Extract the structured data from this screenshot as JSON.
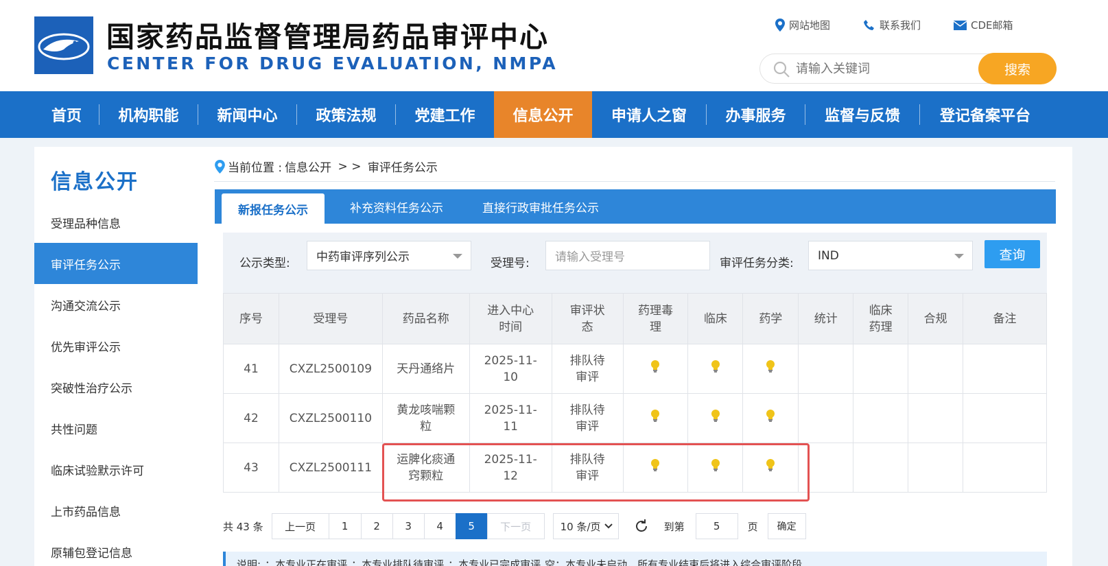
{
  "header": {
    "title": "国家药品监督管理局药品审评中心",
    "subtitle": "CENTER FOR DRUG EVALUATION, NMPA",
    "links": [
      {
        "label": "网站地图",
        "icon": "location-pin-icon"
      },
      {
        "label": "联系我们",
        "icon": "phone-icon"
      },
      {
        "label": "CDE邮箱",
        "icon": "mail-icon"
      }
    ],
    "search": {
      "placeholder": "请输入关键词",
      "button": "搜索"
    }
  },
  "nav": {
    "items": [
      "首页",
      "机构职能",
      "新闻中心",
      "政策法规",
      "党建工作",
      "信息公开",
      "申请人之窗",
      "办事服务",
      "监督与反馈",
      "登记备案平台"
    ],
    "active": "信息公开"
  },
  "sidebar": {
    "title": "信息公开",
    "items": [
      "受理品种信息",
      "审评任务公示",
      "沟通交流公示",
      "优先审评公示",
      "突破性治疗公示",
      "共性问题",
      "临床试验默示许可",
      "上市药品信息",
      "原辅包登记信息"
    ],
    "active": "审评任务公示"
  },
  "breadcrumb": {
    "prefix": "当前位置 : ",
    "parent": "信息公开",
    "sep": " > > ",
    "current": "审评任务公示"
  },
  "tabs": [
    "新报任务公示",
    "补充资料任务公示",
    "直接行政审批任务公示"
  ],
  "filters": {
    "type_label": "公示类型:",
    "type_value": "中药审评序列公示",
    "accept_label": "受理号:",
    "accept_placeholder": "请输入受理号",
    "category_label": "审评任务分类:",
    "category_value": "IND",
    "query_button": "查询"
  },
  "table": {
    "headers": [
      "序号",
      "受理号",
      "药品名称",
      "进入中心\n时间",
      "审评状\n态",
      "药理毒\n理",
      "临床",
      "药学",
      "统计",
      "临床\n药理",
      "合规",
      "备注"
    ],
    "rows": [
      {
        "no": "41",
        "accept": "CXZL2500109",
        "name": "天丹通络片",
        "date": "2025-11-\n10",
        "status": "排队待\n审评",
        "tox": true,
        "clin": true,
        "pharm": true
      },
      {
        "no": "42",
        "accept": "CXZL2500110",
        "name": "黄龙咳喘颗\n粒",
        "date": "2025-11-\n11",
        "status": "排队待\n审评",
        "tox": true,
        "clin": true,
        "pharm": true
      },
      {
        "no": "43",
        "accept": "CXZL2500111",
        "name": "运脾化痰通\n窍颗粒",
        "date": "2025-11-\n12",
        "status": "排队待\n审评",
        "tox": true,
        "clin": true,
        "pharm": true
      }
    ]
  },
  "pager": {
    "total": "共 43 条",
    "prev": "上一页",
    "pages": [
      "1",
      "2",
      "3",
      "4",
      "5"
    ],
    "current": "5",
    "next": "下一页",
    "page_size": "10 条/页",
    "goto_label": "到第",
    "goto_value": "5",
    "unit": "页",
    "confirm": "确定"
  },
  "legend": {
    "label": "说明:",
    "items": [
      "：本专业正在审评",
      "：本专业排队待审评",
      "：本专业已完成审评",
      "空：本专业未启动，所有专业结束后将进入综合审评阶段"
    ]
  },
  "colors": {
    "primary": "#1b70c8",
    "accent": "#e8852a",
    "search_btn": "#f7a623",
    "highlight": "#e35252",
    "bulb": "#f0c419"
  }
}
